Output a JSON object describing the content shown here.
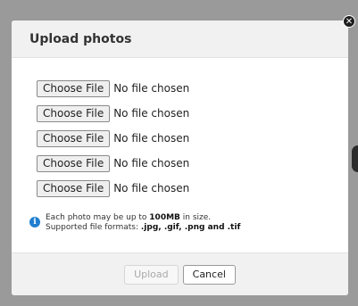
{
  "dialog": {
    "title": "Upload photos",
    "close_icon": "close-icon",
    "file_inputs": [
      {
        "button_label": "Choose File",
        "status": "No file chosen"
      },
      {
        "button_label": "Choose File",
        "status": "No file chosen"
      },
      {
        "button_label": "Choose File",
        "status": "No file chosen"
      },
      {
        "button_label": "Choose File",
        "status": "No file chosen"
      },
      {
        "button_label": "Choose File",
        "status": "No file chosen"
      }
    ],
    "info": {
      "icon": "info-icon",
      "line1_prefix": "Each photo may be up to ",
      "line1_size": "100MB",
      "line1_suffix": " in size.",
      "line2_prefix": "Supported file formats: ",
      "line2_formats": ".jpg, .gif, .png and .tif"
    },
    "footer": {
      "upload_label": "Upload",
      "cancel_label": "Cancel"
    }
  },
  "colors": {
    "overlay": "#9a9a9a",
    "header_bg": "#f1f1f1",
    "info_icon": "#1e7fd0"
  }
}
